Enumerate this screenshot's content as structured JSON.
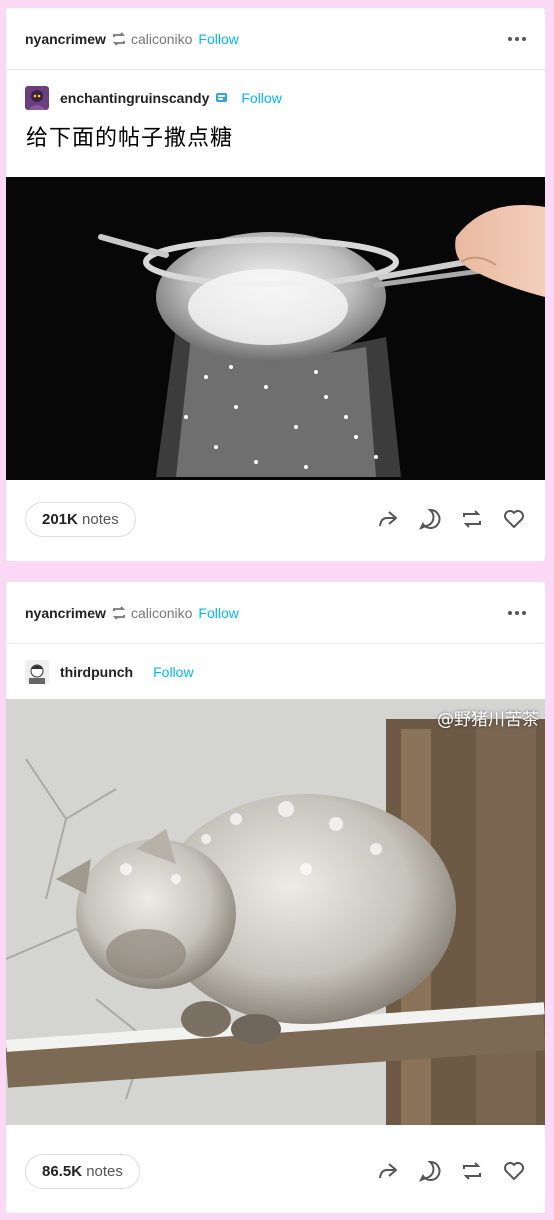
{
  "posts": [
    {
      "reblogger": "nyancrimew",
      "reblogged_from": "caliconiko",
      "follow_label": "Follow",
      "original_author": "enchantingruinscandy",
      "original_follow_label": "Follow",
      "caption": "给下面的帖子撒点糖",
      "image_alt": "",
      "notes_count": "201K",
      "notes_label": "notes"
    },
    {
      "reblogger": "nyancrimew",
      "reblogged_from": "caliconiko",
      "follow_label": "Follow",
      "original_author": "thirdpunch",
      "original_follow_label": "Follow",
      "watermark": "@野猪川苦茶",
      "notes_count": "86.5K",
      "notes_label": "notes"
    }
  ],
  "icons": [
    "reblog-small-icon",
    "more-icon",
    "share-icon",
    "reply-icon",
    "reblog-icon",
    "like-icon"
  ],
  "colors": {
    "background": "#fbd9f6",
    "follow": "#00b8ff"
  }
}
